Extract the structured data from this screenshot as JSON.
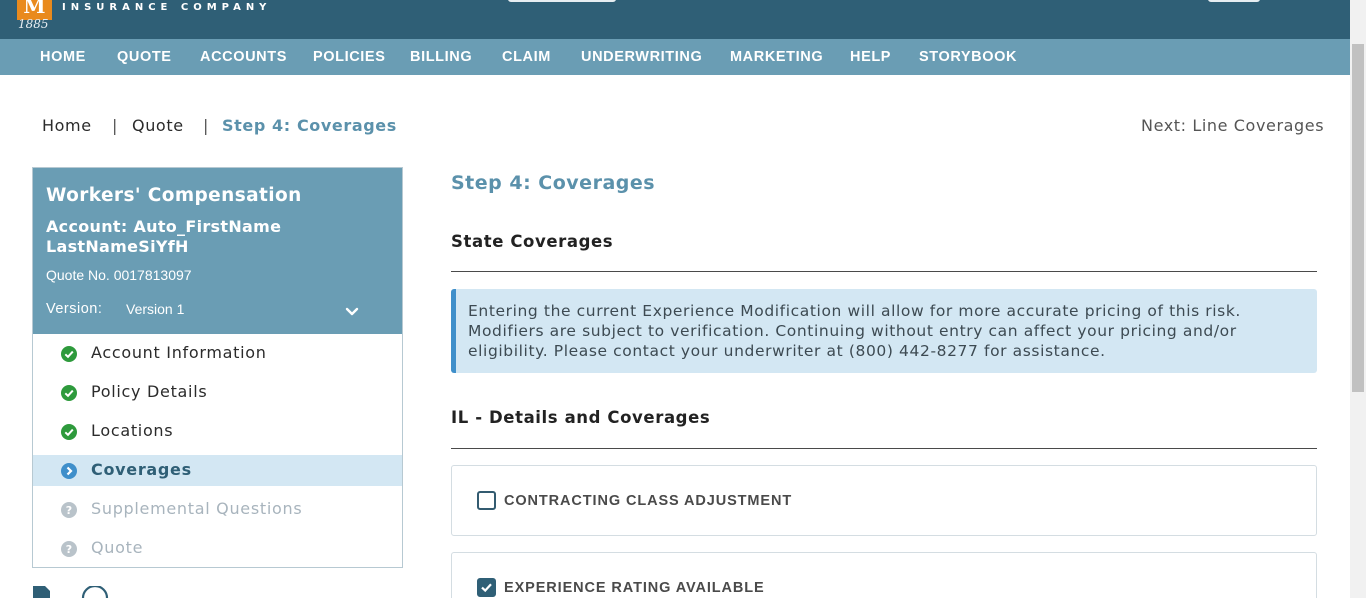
{
  "brand": {
    "logo_letter": "M",
    "logo_year": "1885",
    "logo_tagline": "INSURANCE COMPANY",
    "accent_orange": "#e98a1d",
    "header_color": "#2f5f76",
    "nav_color": "#6a9db4"
  },
  "nav": {
    "items": [
      "HOME",
      "QUOTE",
      "ACCOUNTS",
      "POLICIES",
      "BILLING",
      "CLAIM",
      "UNDERWRITING",
      "MARKETING",
      "HELP",
      "STORYBOOK"
    ]
  },
  "breadcrumb": {
    "home": "Home",
    "sep1": "|",
    "quote": "Quote",
    "sep2": "|",
    "current": "Step 4: Coverages"
  },
  "next_link": "Next: Line Coverages",
  "sidebar": {
    "title": "Workers' Compensation",
    "account": "Account: Auto_FirstName LastNameSiYfH",
    "quote_no": "Quote No. 0017813097",
    "version_label": "Version:",
    "version_value": "Version 1",
    "version_icon": "chevron-down-icon",
    "steps": [
      {
        "label": "Account Information",
        "status": "complete",
        "icon": "check-circle-icon"
      },
      {
        "label": "Policy Details",
        "status": "complete",
        "icon": "check-circle-icon"
      },
      {
        "label": "Locations",
        "status": "complete",
        "icon": "check-circle-icon"
      },
      {
        "label": "Coverages",
        "status": "current",
        "icon": "chevron-right-circle-icon"
      },
      {
        "label": "Supplemental Questions",
        "status": "incomplete",
        "icon": "question-circle-icon"
      },
      {
        "label": "Quote",
        "status": "incomplete",
        "icon": "question-circle-icon"
      }
    ],
    "complete_color": "#2e9a3c",
    "current_color": "#3f8fca",
    "incomplete_color": "#b9c3ca"
  },
  "main": {
    "title": "Step 4: Coverages",
    "state_coverages_heading": "State Coverages",
    "alert_text": "Entering the current Experience Modification will allow for more accurate pricing of this risk. Modifiers are subject to verification. Continuing without entry can affect your pricing and/or eligibility. Please contact your underwriter at (800) 442-8277 for assistance.",
    "il_heading": "IL - Details and Coverages",
    "coverages": [
      {
        "label": "CONTRACTING CLASS ADJUSTMENT",
        "checked": false
      },
      {
        "label": "EXPERIENCE RATING AVAILABLE",
        "checked": true
      }
    ]
  }
}
